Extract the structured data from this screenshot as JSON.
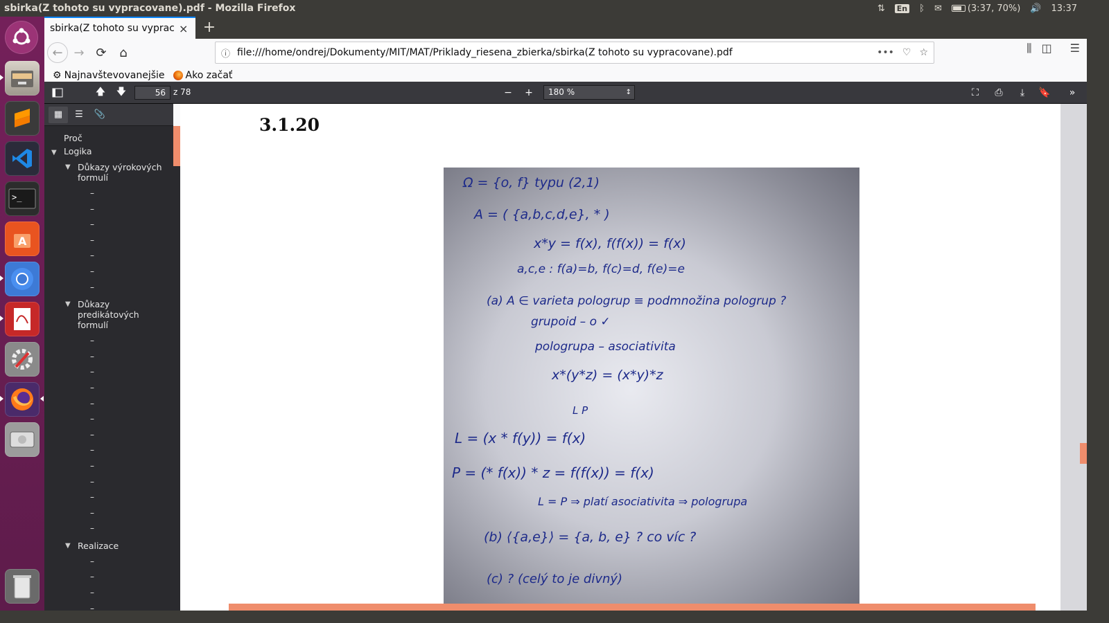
{
  "panel": {
    "window_title": "sbirka(Z tohoto su vypracovane).pdf - Mozilla Firefox",
    "keyboard_layout": "En",
    "battery": "(3:37, 70%)",
    "battery_level": 0.7,
    "clock": "13:37"
  },
  "launcher": {
    "items": [
      "ubuntu-dash",
      "file-manager",
      "sublime-text",
      "vscode",
      "terminal",
      "ubuntu-software",
      "chromium",
      "document-viewer",
      "system-settings",
      "firefox",
      "disks",
      "trash"
    ]
  },
  "browser": {
    "tab_title": "sbirka(Z tohoto su vypracovane).pdf",
    "url": "file:///home/ondrej/Dokumenty/MIT/MAT/Priklady_riesena_zbierka/sbirka(Z tohoto su vypracovane).pdf",
    "bookmarks": [
      {
        "label": "Najnavštevovanejšie",
        "icon": "gear-icon"
      },
      {
        "label": "Ako začať",
        "icon": "firefox-icon"
      }
    ]
  },
  "pdf": {
    "page_number": "56",
    "page_count": "z 78",
    "zoom": "180 %",
    "outline": {
      "top": "Proč",
      "logika": "Logika",
      "section1": "Důkazy výrokových formulí",
      "section1_items": [
        "–",
        "–",
        "–",
        "–",
        "–",
        "–",
        "–"
      ],
      "section2": "Důkazy predikátových formulí",
      "section2_items": [
        "–",
        "–",
        "–",
        "–",
        "–",
        "–",
        "–",
        "–",
        "–",
        "–",
        "–",
        "–",
        "–"
      ],
      "section3": "Realizace",
      "section3_items": [
        "–",
        "–",
        "–",
        "–",
        "–"
      ]
    },
    "section_number": "3.1.20",
    "handwriting": [
      "Ω = {o, f}    typu (2,1)",
      "A = ( {a,b,c,d,e}, * )",
      "x*y = f(x),  f(f(x)) = f(x)",
      "a,c,e :   f(a)=b,  f(c)=d,  f(e)=e",
      "(a)  A ∈ varieta  pologrup  ≡  podmnožina  pologrup ?",
      "grupoid – o  ✓",
      "pologrupa  – asociativita",
      "x*(y*z)  =  (x*y)*z",
      "L                P",
      "L =  (x * f(y))  =  f(x)",
      "P =  (* f(x)) * z  =  f(f(x))  =  f(x)",
      "L = P   ⇒ platí  asociativita  ⇒ pologrupa",
      "(b)   ⟨{a,e}⟩  =  {a, b, e}     ?   co víc ?",
      "(c)    ?    (celý to je divný)"
    ]
  }
}
